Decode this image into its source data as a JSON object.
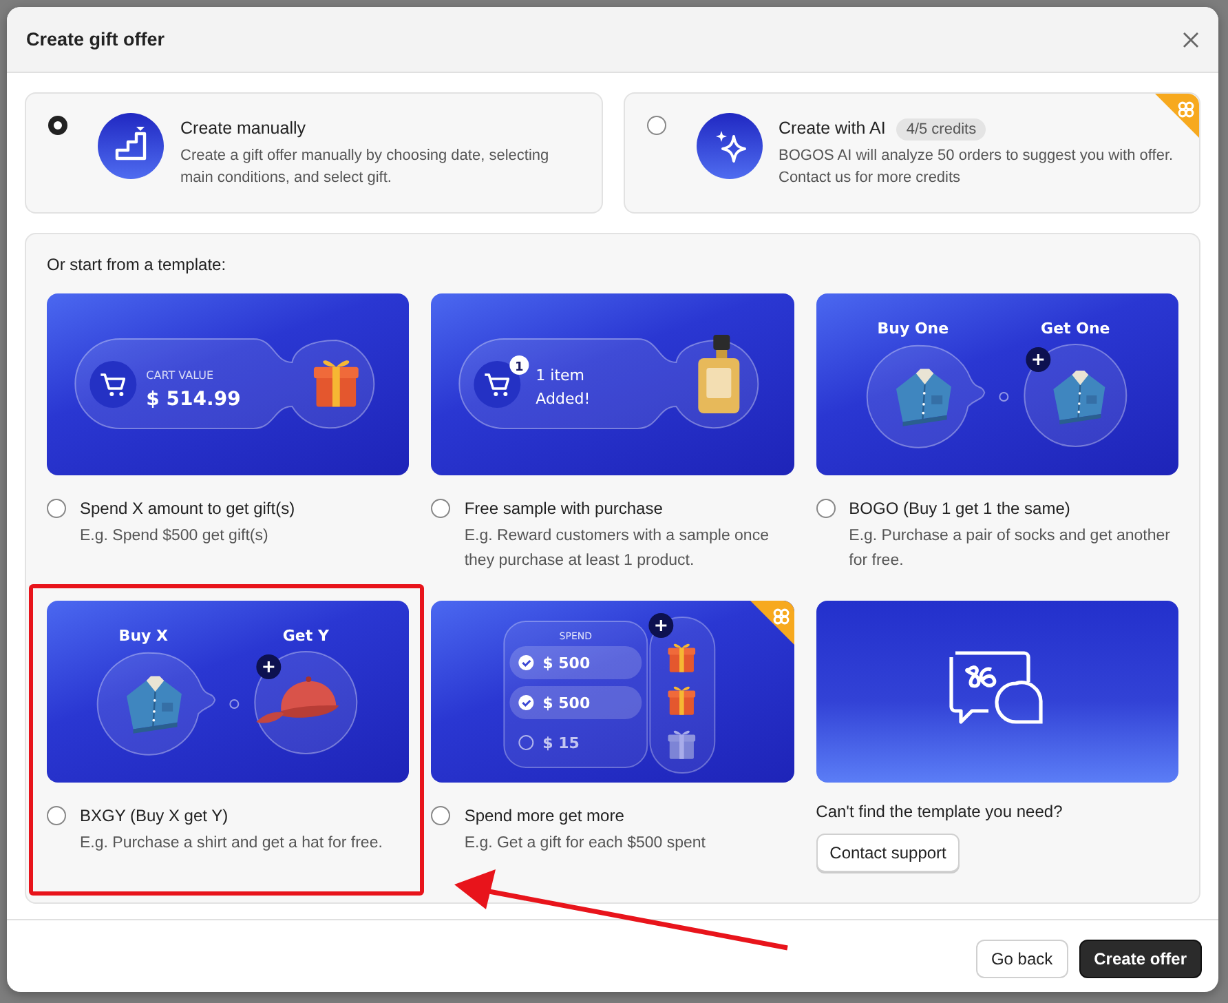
{
  "dialog": {
    "title": "Create gift offer"
  },
  "methods": [
    {
      "kind": "manual",
      "title": "Create manually",
      "description": "Create a gift offer manually by choosing date, selecting main conditions, and select gift.",
      "selected": true,
      "premium": false
    },
    {
      "kind": "ai",
      "title": "Create with AI",
      "badge": "4/5 credits",
      "description": "BOGOS AI will analyze 50 orders to suggest you with offer. Contact us for more credits",
      "selected": false,
      "premium": true
    }
  ],
  "templates_heading": "Or start from a template:",
  "templates": [
    {
      "title": "Spend X amount to get gift(s)",
      "example": "E.g. Spend $500 get gift(s)",
      "selected": false,
      "highlighted": false,
      "banner": {
        "kind": "cart",
        "label": "CART VALUE",
        "amount": "$ 514.99",
        "reward": {
          "kind": "gift"
        }
      }
    },
    {
      "title": "Free sample with purchase",
      "example": "E.g. Reward customers with a sample once they purchase at least 1 product.",
      "selected": false,
      "highlighted": false,
      "banner": {
        "kind": "item",
        "count": "1",
        "line1": "1 item",
        "line2": "Added!",
        "reward": {
          "kind": "perfume"
        }
      }
    },
    {
      "title": "BOGO (Buy 1 get 1 the same)",
      "example": "E.g. Purchase a pair of socks and get another for free.",
      "selected": false,
      "highlighted": false,
      "banner": {
        "kind": "pair",
        "left": "Buy One",
        "right": "Get One",
        "reward": {
          "kind": "shirt"
        }
      }
    },
    {
      "title": "BXGY (Buy X get Y)",
      "example": "E.g. Purchase a shirt and get a hat for free.",
      "selected": false,
      "highlighted": true,
      "banner": {
        "kind": "pair",
        "left": "Buy X",
        "right": "Get Y",
        "reward": {
          "kind": "cap"
        }
      }
    },
    {
      "title": "Spend more get more",
      "example": "E.g. Get a gift for each $500 spent",
      "selected": false,
      "highlighted": false,
      "banner": {
        "kind": "tiers",
        "label": "SPEND",
        "premium": true,
        "tiers": [
          {
            "amount": "$ 500",
            "checked": true
          },
          {
            "amount": "$ 500",
            "checked": true
          },
          {
            "amount": "$ 15",
            "checked": false
          }
        ]
      }
    }
  ],
  "support": {
    "question": "Can't find the template you need?",
    "button": "Contact support"
  },
  "footer": {
    "buttons": [
      {
        "label": "Go back",
        "kind": "secondary"
      },
      {
        "label": "Create offer",
        "kind": "primary"
      }
    ]
  },
  "annotation_arrow": true
}
